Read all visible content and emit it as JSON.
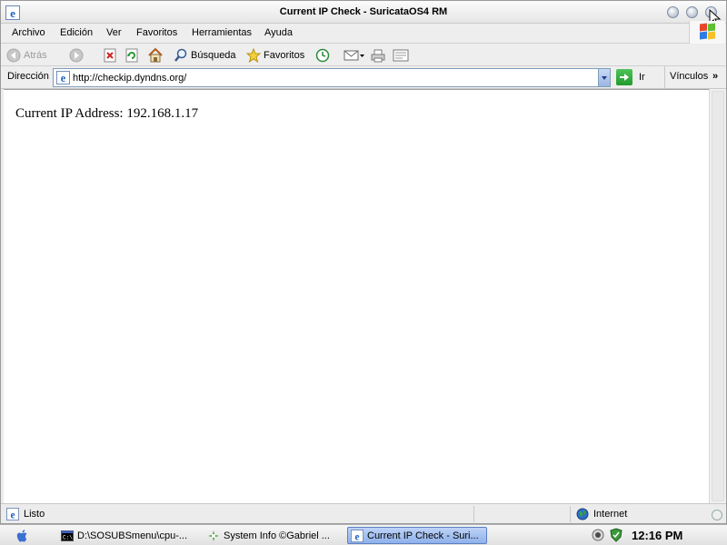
{
  "window": {
    "title": "Current IP Check - SuricataOS4 RM"
  },
  "menu": {
    "items": [
      "Archivo",
      "Edición",
      "Ver",
      "Favoritos",
      "Herramientas",
      "Ayuda"
    ]
  },
  "toolbar": {
    "back_label": "Atrás",
    "search_label": "Búsqueda",
    "favorites_label": "Favoritos"
  },
  "address": {
    "label": "Dirección",
    "url": "http://checkip.dyndns.org/",
    "go_label": "Ir",
    "links_label": "Vínculos"
  },
  "page": {
    "text": "Current IP Address: 192.168.1.17"
  },
  "status": {
    "text": "Listo",
    "zone": "Internet"
  },
  "taskbar": {
    "tasks": [
      {
        "label": "D:\\SOSUBSmenu\\cpu-...",
        "icon": "console-icon"
      },
      {
        "label": "System Info  ©Gabriel ...",
        "icon": "system-info-icon"
      },
      {
        "label": "Current IP Check - Suri...",
        "icon": "ie-icon",
        "active": true
      }
    ],
    "clock": "12:16 PM"
  },
  "colors": {
    "accent": "#2f7be6",
    "active_task": "#a9c4f1",
    "go_green": "#219a2c"
  }
}
